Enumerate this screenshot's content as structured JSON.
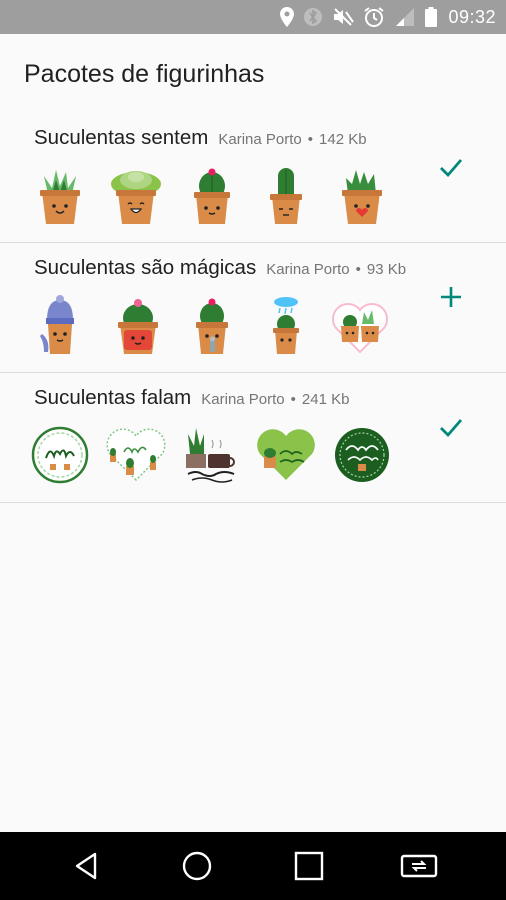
{
  "status_bar": {
    "time": "09:32",
    "icons": [
      "location-icon",
      "bluetooth-icon",
      "mute-icon",
      "alarm-icon",
      "signal-icon",
      "battery-icon"
    ]
  },
  "page": {
    "title": "Pacotes de figurinhas"
  },
  "packs": [
    {
      "name": "Suculentas sentem",
      "author": "Karina Porto",
      "size": "142 Kb",
      "action": "check-icon"
    },
    {
      "name": "Suculentas são mágicas",
      "author": "Karina Porto",
      "size": "93 Kb",
      "action": "add-icon"
    },
    {
      "name": "Suculentas falam",
      "author": "Karina Porto",
      "size": "241 Kb",
      "action": "check-icon"
    }
  ],
  "colors": {
    "accent": "#00897b",
    "status_bar": "#9e9e9e",
    "nav_bar": "#000000",
    "pot": "#d98b47",
    "plant": "#2e7d32",
    "divider": "#dcdcdc"
  },
  "nav_bar": {
    "icons": [
      "back-icon",
      "home-icon",
      "recents-icon",
      "rotate-screen-icon"
    ]
  }
}
